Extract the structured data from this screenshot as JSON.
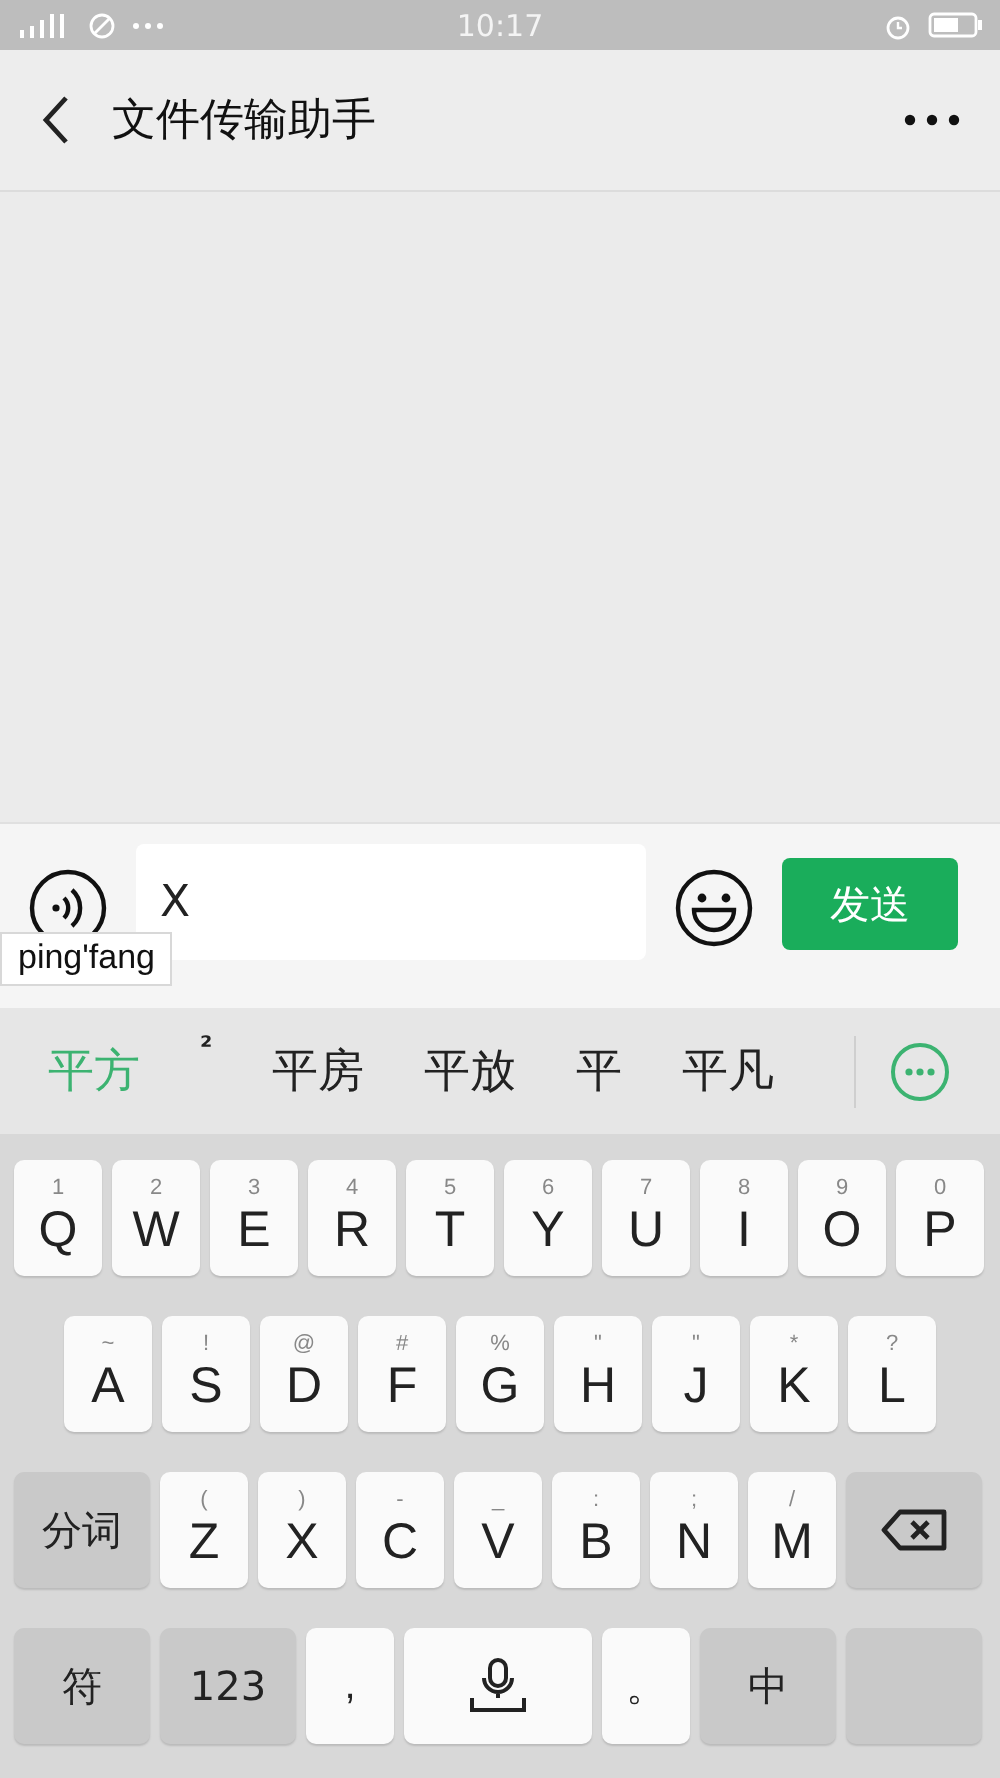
{
  "status_bar": {
    "time": "10:17"
  },
  "header": {
    "title": "文件传输助手"
  },
  "input": {
    "value": "X",
    "send_label": "发送",
    "composition": "ping'fang"
  },
  "candidates": [
    {
      "text": "平方",
      "selected": true
    },
    {
      "text": "²",
      "selected": false
    },
    {
      "text": "平房",
      "selected": false
    },
    {
      "text": "平放",
      "selected": false
    },
    {
      "text": "平",
      "selected": false
    },
    {
      "text": "平凡",
      "selected": false
    }
  ],
  "keyboard": {
    "rows": [
      [
        {
          "kind": "letter",
          "label": "Q",
          "sub": "1"
        },
        {
          "kind": "letter",
          "label": "W",
          "sub": "2"
        },
        {
          "kind": "letter",
          "label": "E",
          "sub": "3"
        },
        {
          "kind": "letter",
          "label": "R",
          "sub": "4"
        },
        {
          "kind": "letter",
          "label": "T",
          "sub": "5"
        },
        {
          "kind": "letter",
          "label": "Y",
          "sub": "6"
        },
        {
          "kind": "letter",
          "label": "U",
          "sub": "7"
        },
        {
          "kind": "letter",
          "label": "I",
          "sub": "8"
        },
        {
          "kind": "letter",
          "label": "O",
          "sub": "9"
        },
        {
          "kind": "letter",
          "label": "P",
          "sub": "0"
        }
      ],
      [
        {
          "kind": "letter",
          "label": "A",
          "sub": "~"
        },
        {
          "kind": "letter",
          "label": "S",
          "sub": "!"
        },
        {
          "kind": "letter",
          "label": "D",
          "sub": "@"
        },
        {
          "kind": "letter",
          "label": "F",
          "sub": "#"
        },
        {
          "kind": "letter",
          "label": "G",
          "sub": "%"
        },
        {
          "kind": "letter",
          "label": "H",
          "sub": "\""
        },
        {
          "kind": "letter",
          "label": "J",
          "sub": "\""
        },
        {
          "kind": "letter",
          "label": "K",
          "sub": "*"
        },
        {
          "kind": "letter",
          "label": "L",
          "sub": "?"
        }
      ],
      [
        {
          "kind": "function",
          "label": "分词"
        },
        {
          "kind": "letter",
          "label": "Z",
          "sub": "("
        },
        {
          "kind": "letter",
          "label": "X",
          "sub": ")"
        },
        {
          "kind": "letter",
          "label": "C",
          "sub": "-"
        },
        {
          "kind": "letter",
          "label": "V",
          "sub": "_"
        },
        {
          "kind": "letter",
          "label": "B",
          "sub": ":"
        },
        {
          "kind": "letter",
          "label": "N",
          "sub": ";"
        },
        {
          "kind": "letter",
          "label": "M",
          "sub": "/"
        },
        {
          "kind": "backspace"
        }
      ],
      [
        {
          "kind": "function",
          "label": "符"
        },
        {
          "kind": "function",
          "label": "123"
        },
        {
          "kind": "punct",
          "label": ","
        },
        {
          "kind": "space"
        },
        {
          "kind": "punct",
          "label": "。"
        },
        {
          "kind": "function",
          "label": "中"
        },
        {
          "kind": "blank"
        }
      ]
    ]
  }
}
